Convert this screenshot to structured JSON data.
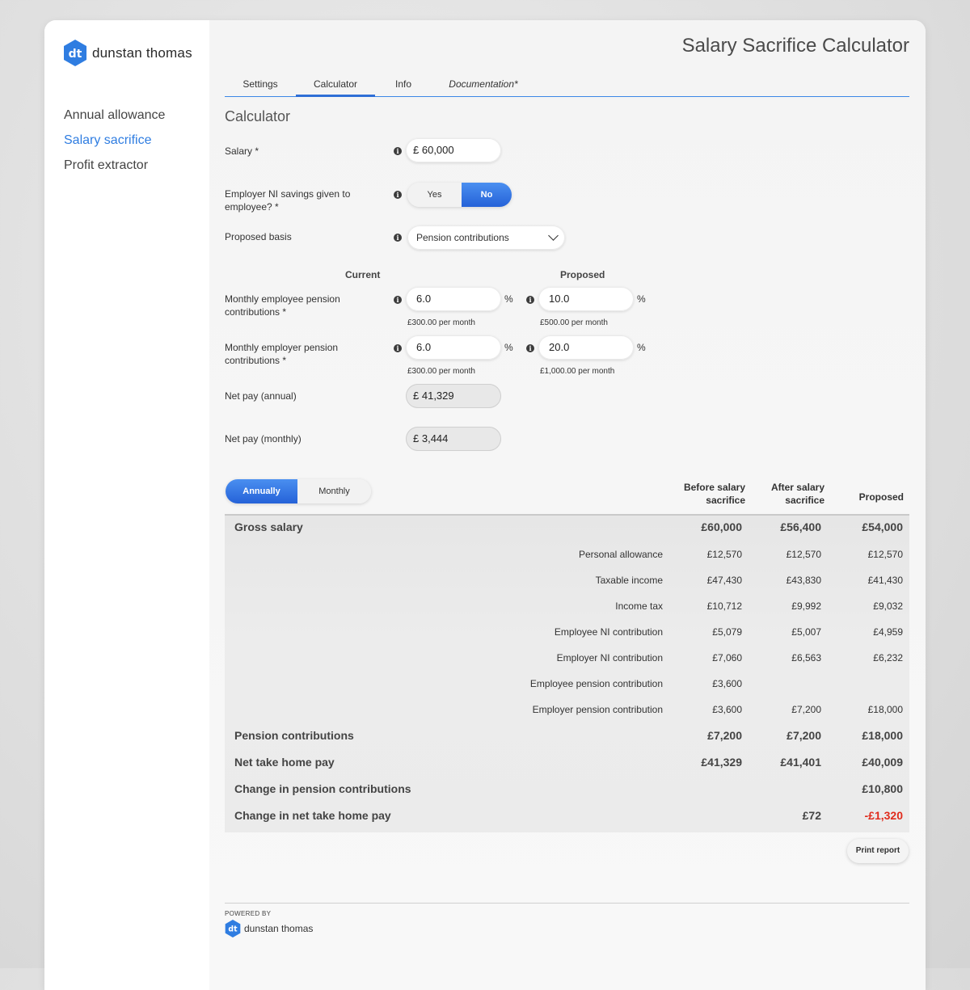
{
  "brand": {
    "name": "dunstan thomas",
    "mark": "dt"
  },
  "sidebar": {
    "items": [
      {
        "label": "Annual allowance",
        "active": false
      },
      {
        "label": "Salary sacrifice",
        "active": true
      },
      {
        "label": "Profit extractor",
        "active": false
      }
    ]
  },
  "header": {
    "title": "Salary Sacrifice Calculator"
  },
  "tabs": [
    {
      "label": "Settings",
      "active": false
    },
    {
      "label": "Calculator",
      "active": true
    },
    {
      "label": "Info",
      "active": false
    },
    {
      "label": "Documentation*",
      "active": false
    }
  ],
  "form": {
    "section_title": "Calculator",
    "salary": {
      "label": "Salary *",
      "prefix": "£",
      "value": "60,000"
    },
    "ni_savings": {
      "label": "Employer NI savings given to employee? *",
      "yes": "Yes",
      "no": "No",
      "selected": "No"
    },
    "basis": {
      "label": "Proposed basis",
      "value": "Pension contributions"
    },
    "col_current": "Current",
    "col_proposed": "Proposed",
    "employee_pension": {
      "label": "Monthly employee pension contributions *",
      "current": "6.0",
      "current_note": "£300.00 per month",
      "proposed": "10.0",
      "proposed_note": "£500.00 per month",
      "unit": "%"
    },
    "employer_pension": {
      "label": "Monthly employer pension contributions *",
      "current": "6.0",
      "current_note": "£300.00 per month",
      "proposed": "20.0",
      "proposed_note": "£1,000.00 per month",
      "unit": "%"
    },
    "net_annual": {
      "label": "Net pay (annual)",
      "prefix": "£",
      "value": "41,329"
    },
    "net_monthly": {
      "label": "Net pay (monthly)",
      "prefix": "£",
      "value": "3,444"
    }
  },
  "period_toggle": {
    "annually": "Annually",
    "monthly": "Monthly",
    "selected": "Annually"
  },
  "table": {
    "headers": [
      "Before salary sacrifice",
      "After salary sacrifice",
      "Proposed"
    ],
    "header_lines": [
      [
        "Before salary",
        "sacrifice"
      ],
      [
        "After salary",
        "sacrifice"
      ],
      [
        "Proposed"
      ]
    ],
    "rows": [
      {
        "label": "Gross salary",
        "type": "major",
        "values": [
          "£60,000",
          "£56,400",
          "£54,000"
        ]
      },
      {
        "label": "Personal allowance",
        "type": "minor",
        "values": [
          "£12,570",
          "£12,570",
          "£12,570"
        ]
      },
      {
        "label": "Taxable income",
        "type": "minor",
        "values": [
          "£47,430",
          "£43,830",
          "£41,430"
        ]
      },
      {
        "label": "Income tax",
        "type": "minor",
        "values": [
          "£10,712",
          "£9,992",
          "£9,032"
        ]
      },
      {
        "label": "Employee NI contribution",
        "type": "minor",
        "values": [
          "£5,079",
          "£5,007",
          "£4,959"
        ]
      },
      {
        "label": "Employer NI contribution",
        "type": "minor",
        "values": [
          "£7,060",
          "£6,563",
          "£6,232"
        ]
      },
      {
        "label": "Employee pension contribution",
        "type": "minor",
        "values": [
          "£3,600",
          "",
          ""
        ]
      },
      {
        "label": "Employer pension contribution",
        "type": "minor",
        "values": [
          "£3,600",
          "£7,200",
          "£18,000"
        ]
      },
      {
        "label": "Pension contributions",
        "type": "major",
        "values": [
          "£7,200",
          "£7,200",
          "£18,000"
        ]
      },
      {
        "label": "Net take home pay",
        "type": "major",
        "values": [
          "£41,329",
          "£41,401",
          "£40,009"
        ]
      },
      {
        "label": "Change in pension contributions",
        "type": "major",
        "values": [
          "",
          "",
          "£10,800"
        ]
      },
      {
        "label": "Change in net take home pay",
        "type": "major",
        "values": [
          "",
          "£72",
          "-£1,320"
        ]
      }
    ],
    "negative_color": "#e02a1b"
  },
  "print_button": "Print report",
  "footer": {
    "powered_by": "POWERED BY",
    "brand": "dunstan thomas"
  },
  "colors": {
    "accent": "#2f7de1",
    "toggle_on": "#2f6fd6"
  }
}
